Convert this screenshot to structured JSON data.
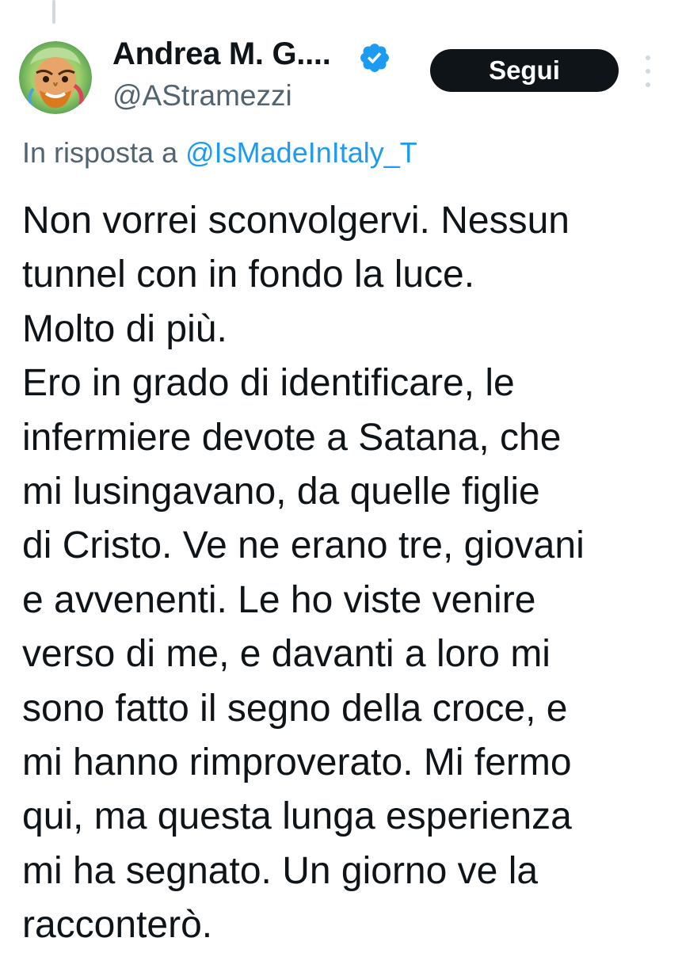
{
  "author": {
    "display_name": "Andrea M. G....",
    "handle": "@AStramezzi",
    "avatar_icon": "avatar",
    "verified_icon": "verified-badge-icon"
  },
  "actions": {
    "follow_label": "Segui",
    "more_icon": "more-options-icon"
  },
  "reply": {
    "prefix": "In risposta a ",
    "mention": "@IsMadeInItaly_T"
  },
  "tweet": {
    "lines": [
      "Non vorrei sconvolgervi. Nessun",
      "tunnel con in fondo la luce.",
      "Molto di più.",
      "Ero in grado di identificare, le",
      "infermiere devote a Satana, che",
      "mi lusingavano, da quelle figlie",
      "di Cristo. Ve ne erano tre, giovani",
      "e avvenenti. Le ho viste venire",
      "verso di me, e davanti a loro mi",
      "sono fatto il segno della croce, e",
      "mi hanno rimproverato. Mi fermo",
      "qui, ma questa lunga esperienza",
      "mi ha segnato. Un giorno ve la",
      "racconterò."
    ]
  },
  "colors": {
    "text_primary": "#0f1419",
    "text_secondary": "#536471",
    "accent": "#1d9bf0",
    "button_bg": "#0f1419",
    "button_text": "#ffffff"
  }
}
